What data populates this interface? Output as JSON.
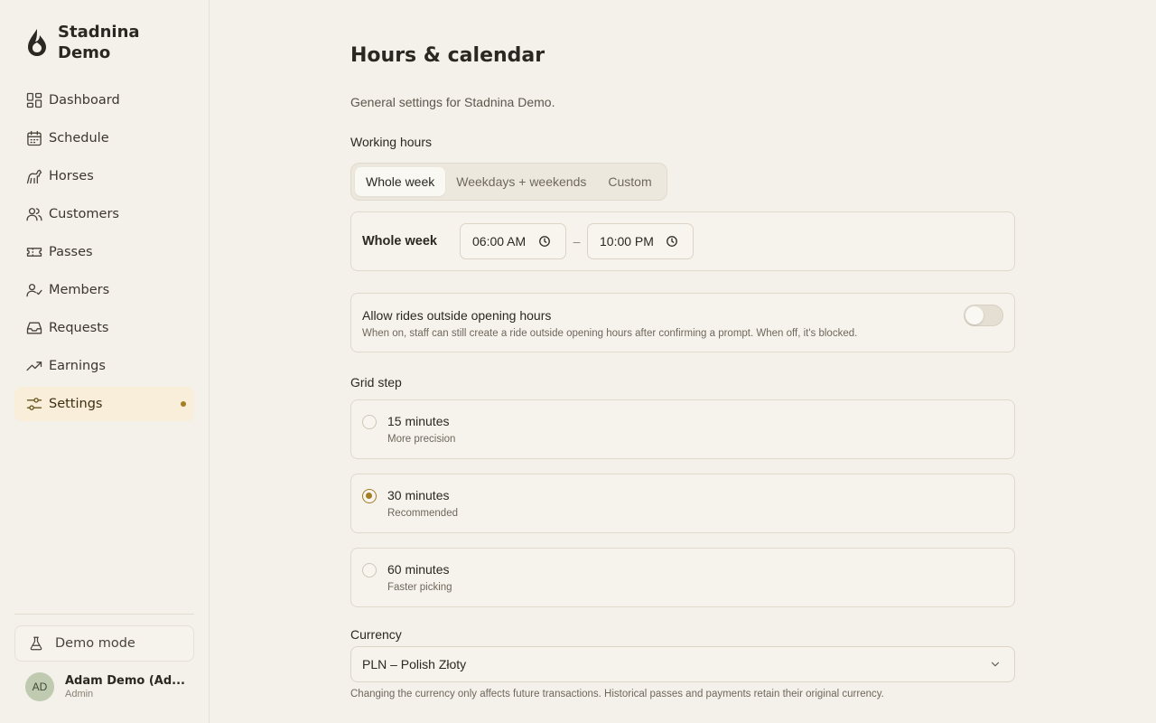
{
  "brand": {
    "name": "Stadnina Demo",
    "logo_icon": "drop-logo-icon"
  },
  "sidebar": {
    "items": [
      {
        "label": "Dashboard",
        "icon": "grid-icon"
      },
      {
        "label": "Schedule",
        "icon": "calendar-icon"
      },
      {
        "label": "Horses",
        "icon": "horse-icon"
      },
      {
        "label": "Customers",
        "icon": "users-icon"
      },
      {
        "label": "Passes",
        "icon": "ticket-icon"
      },
      {
        "label": "Members",
        "icon": "user-check-icon"
      },
      {
        "label": "Requests",
        "icon": "inbox-icon"
      },
      {
        "label": "Earnings",
        "icon": "trending-up-icon"
      },
      {
        "label": "Settings",
        "icon": "sliders-icon",
        "active": true
      }
    ],
    "demo_mode": "Demo mode",
    "user": {
      "initials": "AD",
      "name": "Adam Demo (Ad...",
      "role": "Admin"
    }
  },
  "page": {
    "title": "Hours & calendar",
    "subtitle": "General settings for Stadnina Demo."
  },
  "working_hours": {
    "label": "Working hours",
    "tabs": [
      "Whole week",
      "Weekdays + weekends",
      "Custom"
    ],
    "selected_tab": "Whole week",
    "row_label": "Whole week",
    "from": "06:00 AM",
    "to": "10:00 PM",
    "separator": "–"
  },
  "outside_hours": {
    "title": "Allow rides outside opening hours",
    "description": "When on, staff can still create a ride outside opening hours after confirming a prompt. When off, it's blocked.",
    "enabled": false
  },
  "grid_step": {
    "label": "Grid step",
    "options": [
      {
        "title": "15 minutes",
        "description": "More precision"
      },
      {
        "title": "30 minutes",
        "description": "Recommended",
        "selected": true
      },
      {
        "title": "60 minutes",
        "description": "Faster picking"
      }
    ]
  },
  "currency": {
    "label": "Currency",
    "value": "PLN – Polish Złoty",
    "help": "Changing the currency only affects future transactions. Historical passes and payments retain their original currency."
  },
  "colors": {
    "accent": "#a47d27",
    "background": "#f4f1ea",
    "active_bg": "#f8eed9"
  }
}
